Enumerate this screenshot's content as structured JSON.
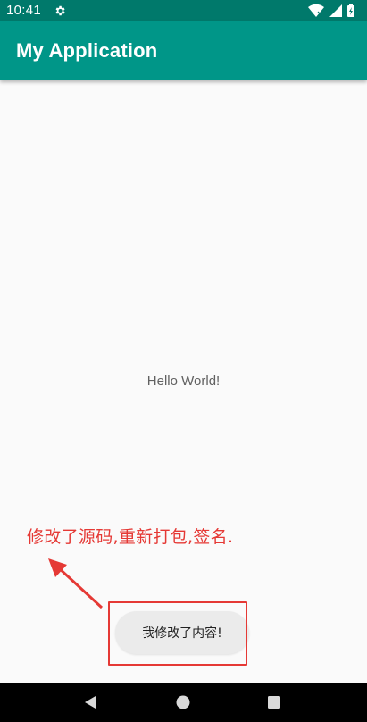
{
  "status_bar": {
    "time": "10:41",
    "icons": [
      "gear-icon",
      "wifi-icon",
      "signal-icon",
      "battery-icon"
    ]
  },
  "app_bar": {
    "title": "My Application",
    "color": "#009688"
  },
  "content": {
    "hello_text": "Hello World!"
  },
  "annotation": {
    "text": "修改了源码,重新打包,签名.",
    "color": "#e53935"
  },
  "toast": {
    "text": "我修改了内容!"
  },
  "nav_bar": {
    "buttons": [
      "back-icon",
      "home-icon",
      "recents-icon"
    ]
  }
}
